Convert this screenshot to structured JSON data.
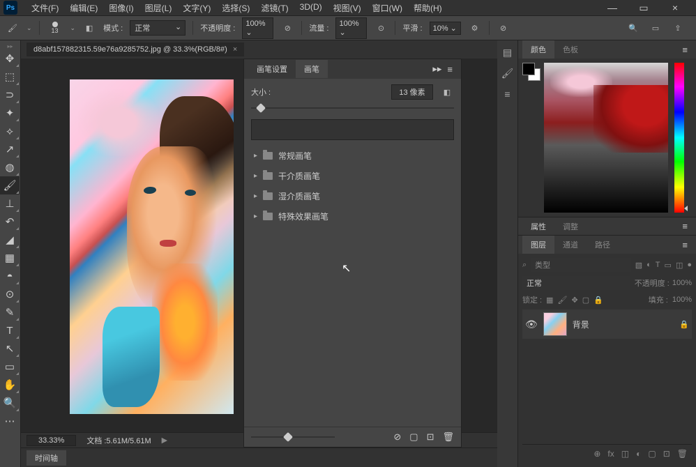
{
  "menu": [
    "文件(F)",
    "编辑(E)",
    "图像(I)",
    "图层(L)",
    "文字(Y)",
    "选择(S)",
    "滤镜(T)",
    "3D(D)",
    "视图(V)",
    "窗口(W)",
    "帮助(H)"
  ],
  "options": {
    "brush_size": "13",
    "mode_label": "模式 :",
    "mode_value": "正常",
    "opacity_label": "不透明度 :",
    "opacity_value": "100%",
    "flow_label": "流量 :",
    "flow_value": "100%",
    "smooth_label": "平滑 :",
    "smooth_value": "10%"
  },
  "doc": {
    "tab_title": "d8abf157882315.59e76a9285752.jpg @ 33.3%(RGB/8#)",
    "zoom": "33.33%",
    "status": "文档 :5.61M/5.61M"
  },
  "brush_panel": {
    "tab_settings": "画笔设置",
    "tab_brush": "画笔",
    "size_label": "大小 :",
    "size_value": "13 像素",
    "folders": [
      "常规画笔",
      "干介质画笔",
      "湿介质画笔",
      "特殊效果画笔"
    ]
  },
  "color_panel": {
    "tab_color": "颜色",
    "tab_swatch": "色板"
  },
  "prop_panel": {
    "tab_prop": "属性",
    "tab_adjust": "调整"
  },
  "layers_panel": {
    "tab_layers": "图层",
    "tab_channels": "通道",
    "tab_paths": "路径",
    "filter_placeholder": "类型",
    "mode": "正常",
    "opacity_label": "不透明度 :",
    "opacity_value": "100%",
    "lock_label": "锁定 :",
    "fill_label": "填充 :",
    "fill_value": "100%",
    "layer_name": "背景"
  },
  "timeline": {
    "label": "时间轴"
  }
}
